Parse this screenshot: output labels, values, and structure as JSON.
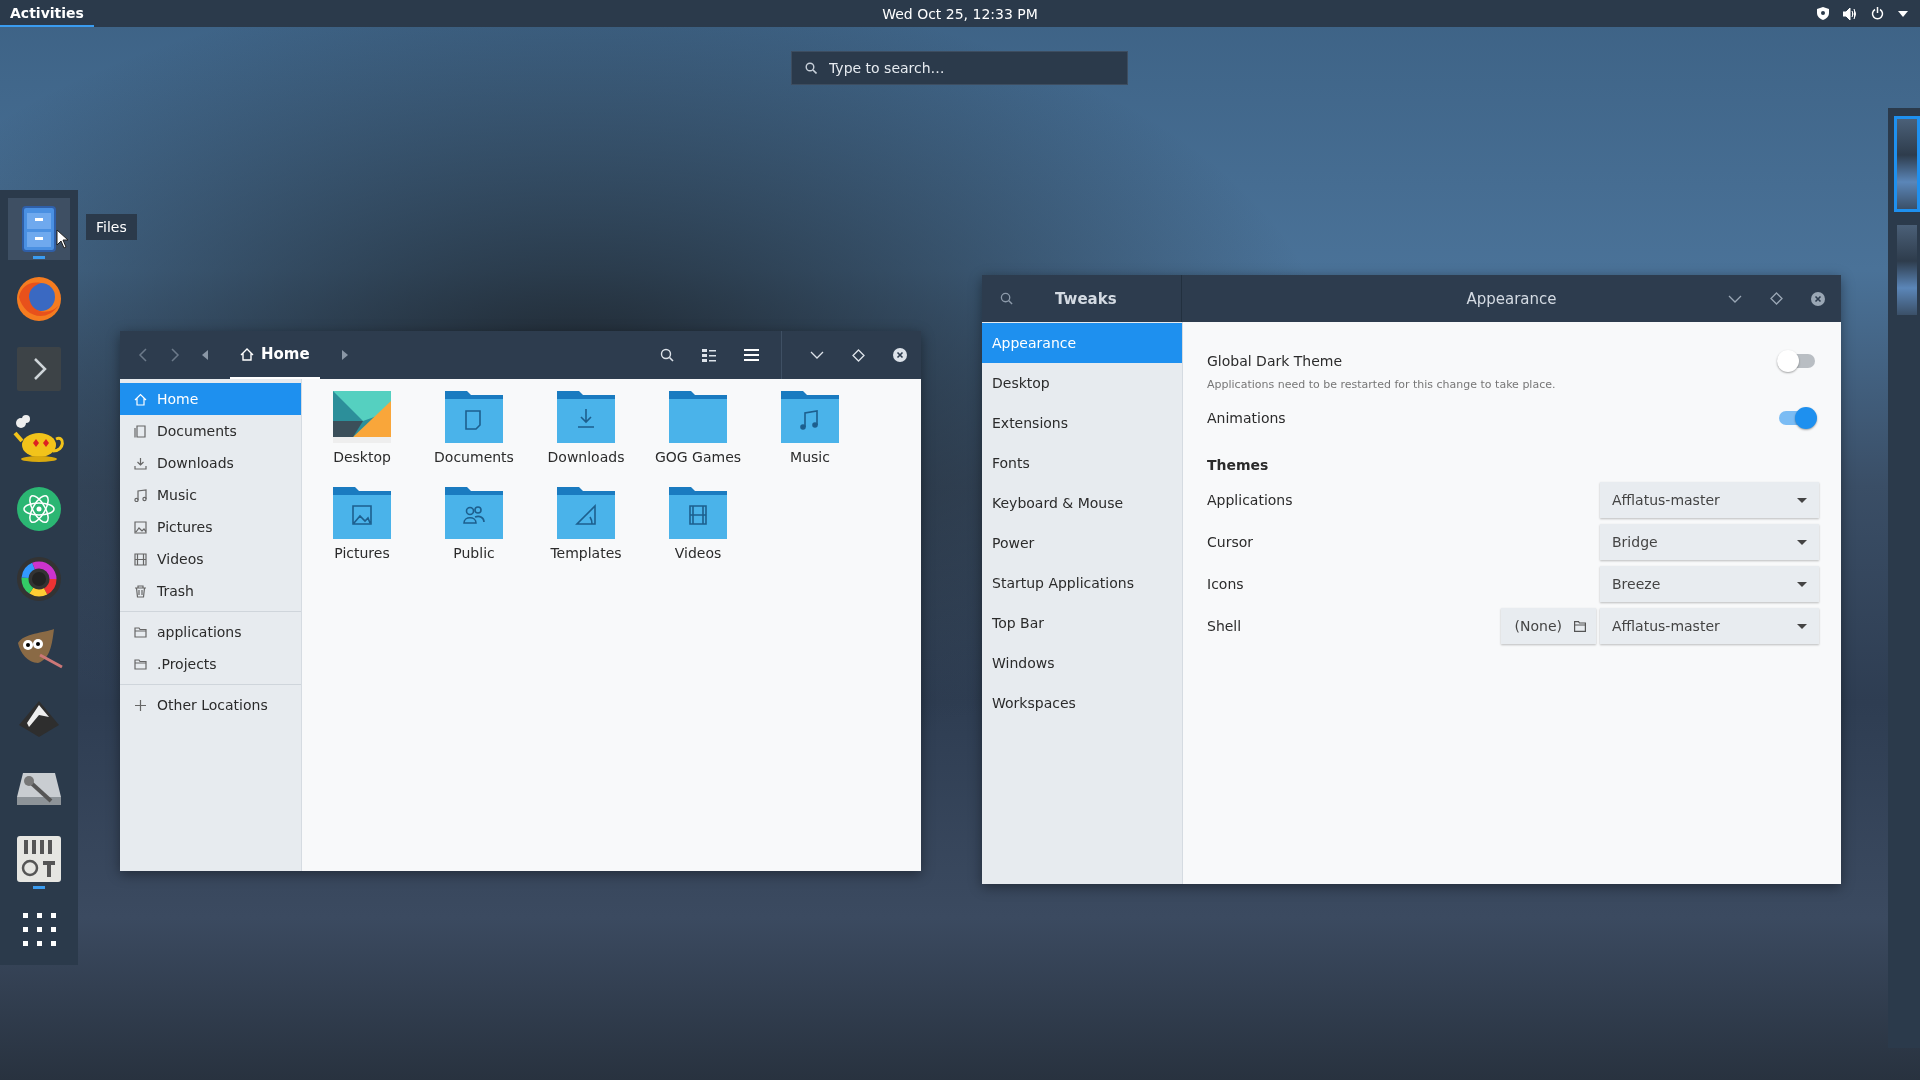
{
  "top_bar": {
    "activities": "Activities",
    "clock": "Wed Oct 25, 12:33 PM"
  },
  "search": {
    "placeholder": "Type to search…"
  },
  "dock": {
    "tooltip": "Files",
    "items": [
      {
        "kind": "files",
        "hovered": true,
        "running": true
      },
      {
        "kind": "browser",
        "hovered": false,
        "running": false
      },
      {
        "kind": "terminal",
        "hovered": false,
        "running": false
      },
      {
        "kind": "teapot",
        "hovered": false,
        "running": false
      },
      {
        "kind": "atom",
        "hovered": false,
        "running": false
      },
      {
        "kind": "colorwheel",
        "hovered": false,
        "running": false
      },
      {
        "kind": "mascot",
        "hovered": false,
        "running": false
      },
      {
        "kind": "diamond",
        "hovered": false,
        "running": false
      },
      {
        "kind": "disk",
        "hovered": false,
        "running": false
      },
      {
        "kind": "mixer",
        "hovered": false,
        "running": true
      },
      {
        "kind": "grid",
        "hovered": false,
        "running": false
      }
    ]
  },
  "workspaces": [
    {
      "selected": true
    },
    {
      "selected": false
    }
  ],
  "files_window": {
    "path": "Home",
    "sidebar": [
      [
        {
          "kind": "home",
          "label": "Home",
          "selected": true
        },
        {
          "kind": "document",
          "label": "Documents",
          "selected": false
        },
        {
          "kind": "download",
          "label": "Downloads",
          "selected": false
        },
        {
          "kind": "music",
          "label": "Music",
          "selected": false
        },
        {
          "kind": "picture",
          "label": "Pictures",
          "selected": false
        },
        {
          "kind": "video",
          "label": "Videos",
          "selected": false
        },
        {
          "kind": "trash",
          "label": "Trash",
          "selected": false
        }
      ],
      [
        {
          "kind": "folder",
          "label": "applications",
          "selected": false
        },
        {
          "kind": "folder",
          "label": ".Projects",
          "selected": false
        }
      ],
      [
        {
          "kind": "plus",
          "label": "Other Locations",
          "selected": false
        }
      ]
    ],
    "items": [
      {
        "kind": "desktop",
        "label": "Desktop"
      },
      {
        "kind": "document",
        "label": "Documents"
      },
      {
        "kind": "download",
        "label": "Downloads"
      },
      {
        "kind": "plain",
        "label": "GOG Games"
      },
      {
        "kind": "music",
        "label": "Music"
      },
      {
        "kind": "picture",
        "label": "Pictures"
      },
      {
        "kind": "people",
        "label": "Public"
      },
      {
        "kind": "template",
        "label": "Templates"
      },
      {
        "kind": "video",
        "label": "Videos"
      }
    ]
  },
  "tweaks_window": {
    "title": "Tweaks",
    "page_title": "Appearance",
    "nav": [
      {
        "label": "Appearance",
        "selected": true
      },
      {
        "label": "Desktop",
        "selected": false
      },
      {
        "label": "Extensions",
        "selected": false
      },
      {
        "label": "Fonts",
        "selected": false
      },
      {
        "label": "Keyboard & Mouse",
        "selected": false
      },
      {
        "label": "Power",
        "selected": false
      },
      {
        "label": "Startup Applications",
        "selected": false
      },
      {
        "label": "Top Bar",
        "selected": false
      },
      {
        "label": "Windows",
        "selected": false
      },
      {
        "label": "Workspaces",
        "selected": false
      }
    ],
    "settings": [
      {
        "kind": "switch",
        "label": "Global Dark Theme",
        "on": false,
        "note": "Applications need to be restarted for this change to take place."
      },
      {
        "kind": "switch",
        "label": "Animations",
        "on": true
      },
      {
        "kind": "heading",
        "label": "Themes"
      },
      {
        "kind": "combo",
        "label": "Applications",
        "value": "Afflatus-master"
      },
      {
        "kind": "combo",
        "label": "Cursor",
        "value": "Bridge"
      },
      {
        "kind": "combo",
        "label": "Icons",
        "value": "Breeze"
      },
      {
        "kind": "combo",
        "label": "Shell",
        "value": "Afflatus-master",
        "button": "(None)"
      }
    ]
  }
}
